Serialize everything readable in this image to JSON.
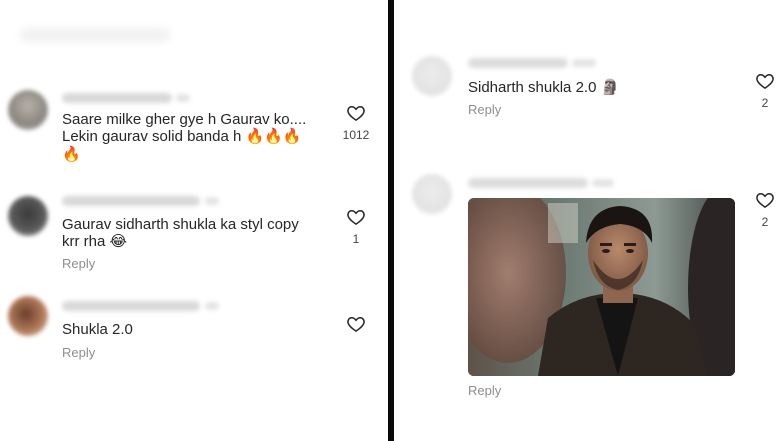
{
  "left_panel": {
    "comments": [
      {
        "text_line1": "Saare milke gher gye h Gaurav ko....",
        "text_line2": "Lekin gaurav solid banda h 🔥🔥🔥",
        "text_line3": "🔥",
        "like_count": "1012"
      },
      {
        "text_line1": "Gaurav sidharth shukla ka styl  copy",
        "text_line2": "krr rha 😂",
        "reply_label": "Reply",
        "like_count": "1"
      },
      {
        "text_line1": "Shukla 2.0",
        "reply_label": "Reply"
      }
    ]
  },
  "right_panel": {
    "comments": [
      {
        "text_line1": "Sidharth shukla 2.0 🗿",
        "reply_label": "Reply",
        "like_count": "2"
      },
      {
        "reply_label": "Reply",
        "like_count": "2",
        "gif_icon": "man-in-leather-jacket-gif"
      }
    ]
  },
  "icons": {
    "like": "heart-outline-icon"
  },
  "colors": {
    "text": "#262626",
    "secondary_text": "#8e8e8e",
    "divider": "#0a0a0a",
    "background": "#ffffff"
  }
}
